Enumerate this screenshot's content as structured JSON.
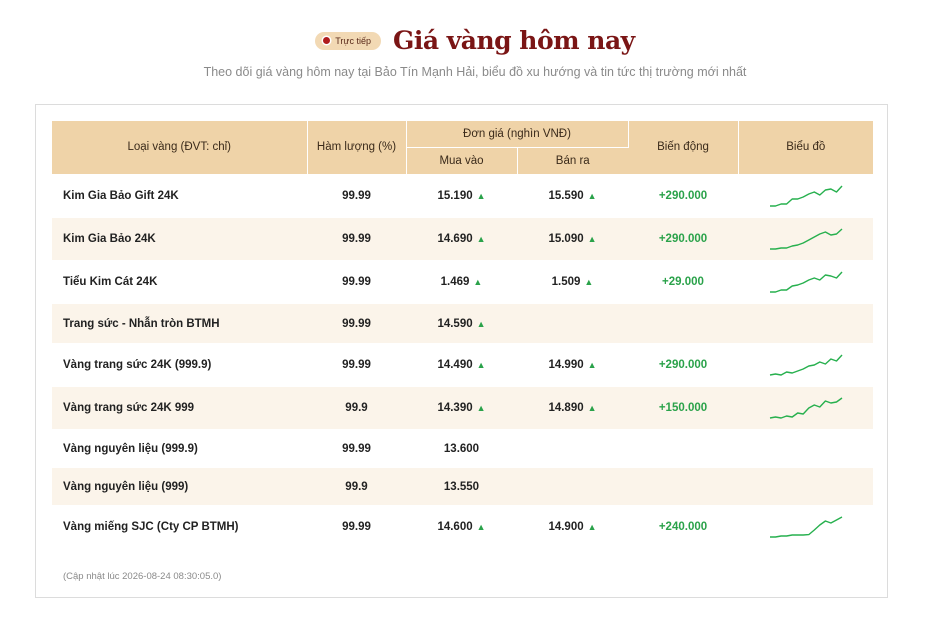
{
  "header": {
    "badge_label": "Trực tiếp",
    "title": "Giá vàng hôm nay",
    "subtitle": "Theo dõi giá vàng hôm nay tại Bảo Tín Mạnh Hải, biểu đồ xu hướng và tin tức thị trường mới nhất"
  },
  "table": {
    "col_type": "Loại vàng (ĐVT: chỉ)",
    "col_purity": "Hàm lượng (%)",
    "col_price": "Đơn giá (nghìn VNĐ)",
    "col_buy": "Mua vào",
    "col_sell": "Bán ra",
    "col_change": "Biến động",
    "col_chart": "Biểu đồ",
    "rows": [
      {
        "name": "Kim Gia Bảo Gift 24K",
        "purity": "99.99",
        "buy": "15.190",
        "buy_up": true,
        "sell": "15.590",
        "sell_up": true,
        "change": "+290.000",
        "spark": [
          0,
          0,
          0.1,
          0.1,
          0.35,
          0.35,
          0.45,
          0.6,
          0.7,
          0.55,
          0.8,
          0.85,
          0.7,
          1
        ]
      },
      {
        "name": "Kim Gia Bảo 24K",
        "purity": "99.99",
        "buy": "14.690",
        "buy_up": true,
        "sell": "15.090",
        "sell_up": true,
        "change": "+290.000",
        "spark": [
          0,
          0,
          0.05,
          0.05,
          0.15,
          0.2,
          0.3,
          0.45,
          0.6,
          0.75,
          0.85,
          0.7,
          0.75,
          1
        ]
      },
      {
        "name": "Tiểu Kim Cát 24K",
        "purity": "99.99",
        "buy": "1.469",
        "buy_up": true,
        "sell": "1.509",
        "sell_up": true,
        "change": "+29.000",
        "spark": [
          0,
          0,
          0.1,
          0.1,
          0.3,
          0.35,
          0.45,
          0.6,
          0.7,
          0.6,
          0.85,
          0.8,
          0.7,
          1
        ]
      },
      {
        "name": "Trang sức - Nhẫn tròn BTMH",
        "purity": "99.99",
        "buy": "14.590",
        "buy_up": true,
        "sell": "",
        "sell_up": false,
        "change": "",
        "spark": []
      },
      {
        "name": "Vàng trang sức 24K (999.9)",
        "purity": "99.99",
        "buy": "14.490",
        "buy_up": true,
        "sell": "14.990",
        "sell_up": true,
        "change": "+290.000",
        "spark": [
          0,
          0.05,
          0,
          0.15,
          0.1,
          0.2,
          0.3,
          0.45,
          0.5,
          0.65,
          0.55,
          0.8,
          0.7,
          1
        ]
      },
      {
        "name": "Vàng trang sức 24K 999",
        "purity": "99.9",
        "buy": "14.390",
        "buy_up": true,
        "sell": "14.890",
        "sell_up": true,
        "change": "+150.000",
        "spark": [
          0,
          0.05,
          0,
          0.1,
          0.05,
          0.25,
          0.2,
          0.5,
          0.65,
          0.55,
          0.85,
          0.75,
          0.8,
          1
        ]
      },
      {
        "name": "Vàng nguyên liệu (999.9)",
        "purity": "99.99",
        "buy": "13.600",
        "buy_up": false,
        "sell": "",
        "sell_up": false,
        "change": "",
        "spark": []
      },
      {
        "name": "Vàng nguyên liệu (999)",
        "purity": "99.9",
        "buy": "13.550",
        "buy_up": false,
        "sell": "",
        "sell_up": false,
        "change": "",
        "spark": []
      },
      {
        "name": "Vàng miếng SJC (Cty CP BTMH)",
        "purity": "99.99",
        "buy": "14.600",
        "buy_up": true,
        "sell": "14.900",
        "sell_up": true,
        "change": "+240.000",
        "spark": [
          0,
          0,
          0.05,
          0.05,
          0.1,
          0.1,
          0.1,
          0.12,
          0.35,
          0.6,
          0.8,
          0.7,
          0.85,
          1
        ]
      }
    ],
    "updated": "(Cập nhật lúc 2026-08-24 08:30:05.0)"
  },
  "colors": {
    "up": "#2aa24a",
    "header_bg": "#efd3a8",
    "title": "#7a1515",
    "spark": "#27b04e"
  },
  "icons": {
    "up_arrow": "triangle-up-icon",
    "live_dot": "live-dot-icon"
  }
}
